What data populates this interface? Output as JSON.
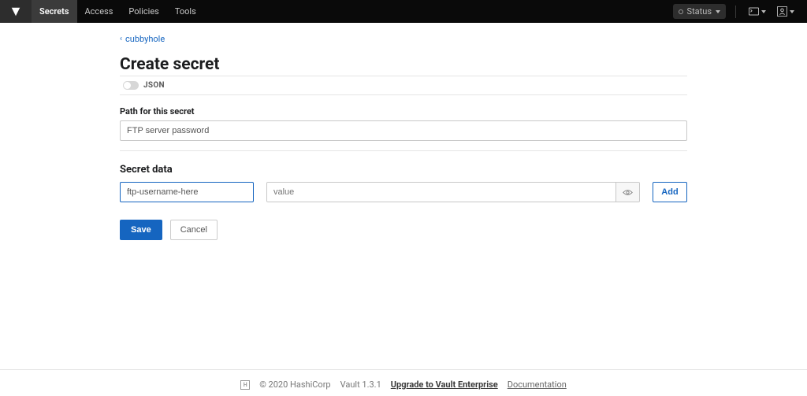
{
  "nav": {
    "items": [
      {
        "label": "Secrets",
        "active": true
      },
      {
        "label": "Access",
        "active": false
      },
      {
        "label": "Policies",
        "active": false
      },
      {
        "label": "Tools",
        "active": false
      }
    ],
    "status_label": "Status"
  },
  "breadcrumb": {
    "parent_label": "cubbyhole"
  },
  "page": {
    "title": "Create secret",
    "json_toggle_label": "JSON",
    "path_label": "Path for this secret",
    "path_value": "FTP server password",
    "secret_data_title": "Secret data",
    "key_value": "ftp-username-here",
    "value_placeholder": "value",
    "add_label": "Add",
    "save_label": "Save",
    "cancel_label": "Cancel"
  },
  "footer": {
    "copyright": "© 2020 HashiCorp",
    "version": "Vault 1.3.1",
    "upgrade_label": "Upgrade to Vault Enterprise",
    "documentation_label": "Documentation"
  }
}
